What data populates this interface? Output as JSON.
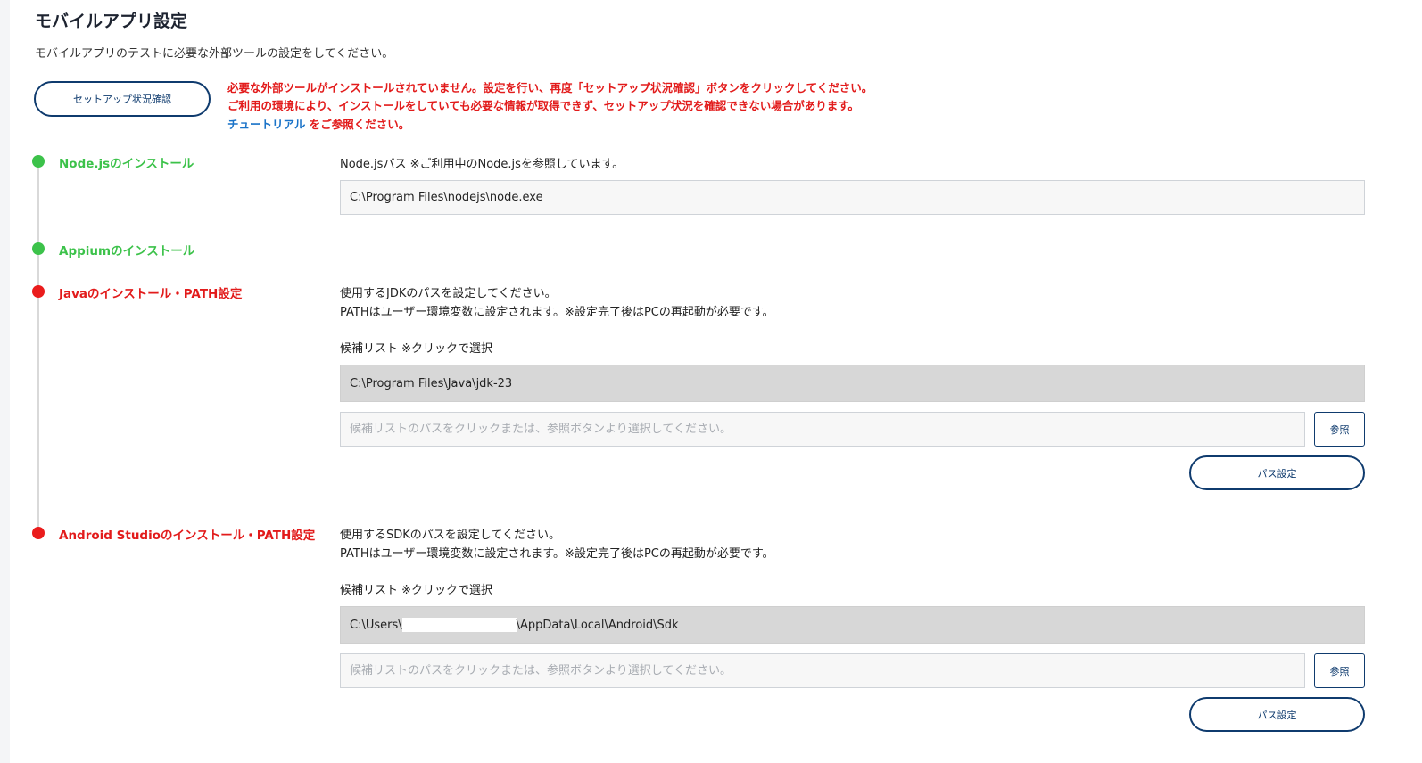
{
  "page": {
    "title": "モバイルアプリ設定",
    "description": "モバイルアプリのテストに必要な外部ツールの設定をしてください。"
  },
  "setup_button": {
    "label": "セットアップ状況確認"
  },
  "warning": {
    "line1": "必要な外部ツールがインストールされていません。設定を行い、再度「セットアップ状況確認」ボタンをクリックしてください。",
    "line2": "ご利用の環境により、インストールをしていても必要な情報が取得できず、セットアップ状況を確認できない場合があります。",
    "tutorial_link": "チュートリアル",
    "line3_suffix": " をご参照ください。",
    "color": "#e21b1b"
  },
  "steps": {
    "node": {
      "label": "Node.jsのインストール",
      "status": "ok",
      "path_label": "Node.jsパス ※ご利用中のNode.jsを参照しています。",
      "path_value": "C:\\Program Files\\nodejs\\node.exe"
    },
    "appium": {
      "label": "Appiumのインストール",
      "status": "ok"
    },
    "java": {
      "label": "Javaのインストール・PATH設定",
      "status": "error",
      "instruction1": "使用するJDKのパスを設定してください。",
      "instruction2": "PATHはユーザー環境変数に設定されます。※設定完了後はPCの再起動が必要です。",
      "candidates_label": "候補リスト ※クリックで選択",
      "candidate": "C:\\Program Files\\Java\\jdk-23",
      "input_placeholder": "候補リストのパスをクリックまたは、参照ボタンより選択してください。",
      "browse_label": "参照",
      "set_path_label": "パス設定"
    },
    "android": {
      "label": "Android Studioのインストール・PATH設定",
      "status": "error",
      "instruction1": "使用するSDKのパスを設定してください。",
      "instruction2": "PATHはユーザー環境変数に設定されます。※設定完了後はPCの再起動が必要です。",
      "candidates_label": "候補リスト ※クリックで選択",
      "candidate_prefix": "C:\\Users\\",
      "candidate_suffix": "\\AppData\\Local\\Android\\Sdk",
      "input_placeholder": "候補リストのパスをクリックまたは、参照ボタンより選択してください。",
      "browse_label": "参照",
      "set_path_label": "パス設定"
    }
  },
  "colors": {
    "ok": "#3cc24a",
    "error": "#ea1c1c",
    "link": "#1a73c8",
    "primary": "#0f3b6e"
  }
}
